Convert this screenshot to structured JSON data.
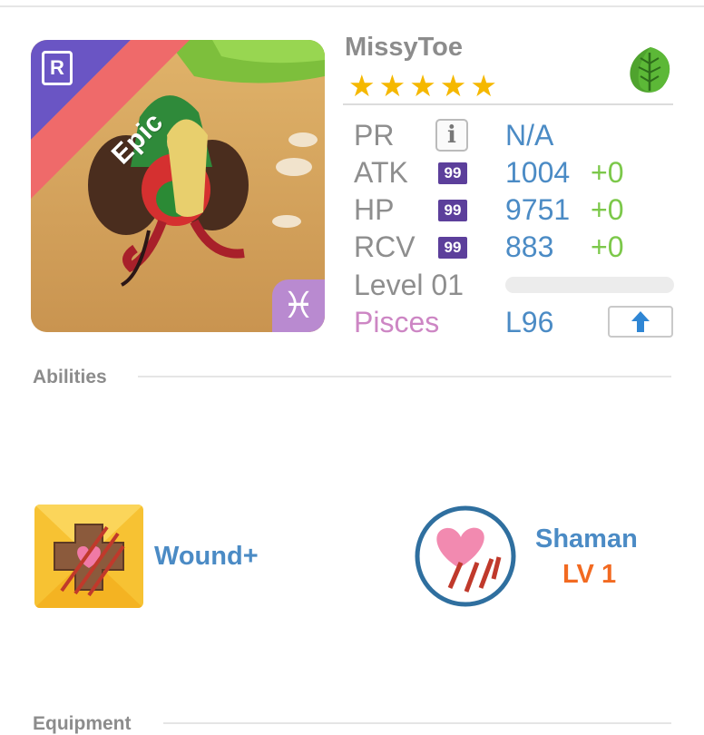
{
  "monster": {
    "name": "MissyToe",
    "rarity": "Epic",
    "rarity_badge": "R",
    "element": "leaf-icon",
    "stars": 5,
    "zodiac_symbol": "♓"
  },
  "stats": {
    "pr": {
      "label": "PR",
      "value": "N/A",
      "icon": "info-icon"
    },
    "atk": {
      "label": "ATK",
      "badge": "99",
      "value": "1004",
      "bonus": "+0"
    },
    "hp": {
      "label": "HP",
      "badge": "99",
      "value": "9751",
      "bonus": "+0"
    },
    "rcv": {
      "label": "RCV",
      "badge": "99",
      "value": "883",
      "bonus": "+0"
    },
    "level": {
      "label": "Level 01",
      "progress": 0
    },
    "zodiac": {
      "label": "Pisces",
      "value": "L96"
    }
  },
  "sections": {
    "abilities": "Abilities",
    "equipment": "Equipment"
  },
  "abilities": [
    {
      "name": "Wound+",
      "icon": "wound-cross-icon"
    },
    {
      "name": "Shaman",
      "level": "LV 1",
      "icon": "shaman-heart-icon"
    }
  ],
  "colors": {
    "accent_blue": "#4b8bc5",
    "bonus_green": "#7cc84a",
    "zodiac_pink": "#cd86c4",
    "level_orange": "#f26a21",
    "badge_purple": "#5c3f9b",
    "epic_ribbon": "#ef6a6a"
  }
}
